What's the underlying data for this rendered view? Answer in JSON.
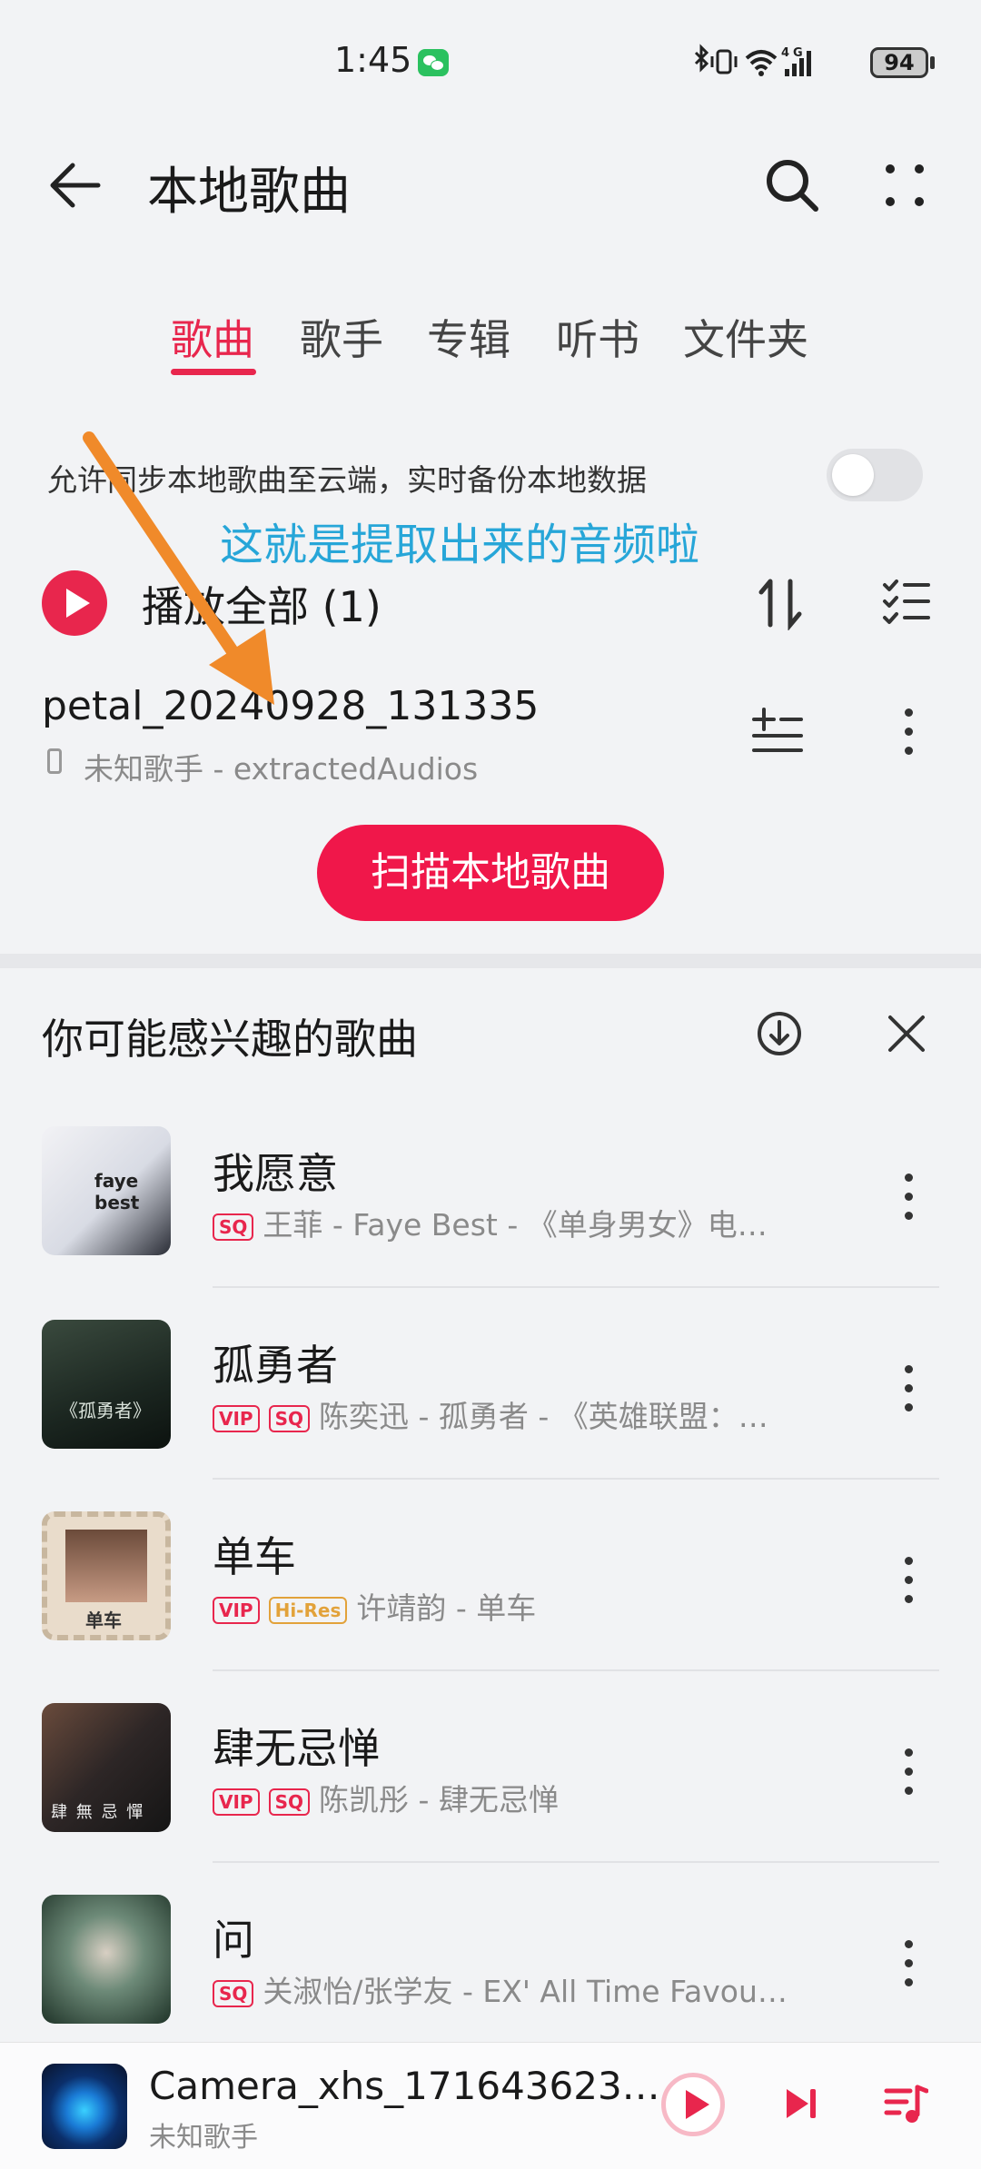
{
  "status_bar": {
    "time": "1:45",
    "battery": "94"
  },
  "header": {
    "title": "本地歌曲"
  },
  "tabs": [
    {
      "label": "歌曲"
    },
    {
      "label": "歌手"
    },
    {
      "label": "专辑"
    },
    {
      "label": "听书"
    },
    {
      "label": "文件夹"
    }
  ],
  "sync": {
    "text": "允许同步本地歌曲至云端，实时备份本地数据"
  },
  "annotation": {
    "text": "这就是提取出来的音频啦"
  },
  "play_all": {
    "label": "播放全部 (1)"
  },
  "local_song": {
    "title": "petal_20240928_131335",
    "subtitle": "未知歌手 - extractedAudios"
  },
  "scan_button": {
    "label": "扫描本地歌曲"
  },
  "recommend": {
    "title": "你可能感兴趣的歌曲",
    "songs": [
      {
        "name": "我愿意",
        "badges": [
          "SQ"
        ],
        "info": "王菲 - Faye Best - 《单身男女》电…",
        "cover_text": "faye best"
      },
      {
        "name": "孤勇者",
        "badges": [
          "VIP",
          "SQ"
        ],
        "info": "陈奕迅 - 孤勇者 - 《英雄联盟：…",
        "cover_text": "《孤勇者》"
      },
      {
        "name": "单车",
        "badges": [
          "VIP",
          "Hi-Res"
        ],
        "info": "许靖韵 - 单车",
        "cover_text": "单车"
      },
      {
        "name": "肆无忌惮",
        "badges": [
          "VIP",
          "SQ"
        ],
        "info": "陈凯彤 - 肆无忌惮",
        "cover_text": "肆 無 忌 憚"
      },
      {
        "name": "问",
        "badges": [
          "SQ"
        ],
        "info": "关淑怡/张学友 - EX' All Time Favou…",
        "cover_text": ""
      }
    ]
  },
  "mini_player": {
    "title": "Camera_xhs_171643623…",
    "subtitle": "未知歌手"
  },
  "colors": {
    "accent": "#e8264d",
    "annotation": "#27a6d8",
    "arrow": "#f08a2a"
  }
}
